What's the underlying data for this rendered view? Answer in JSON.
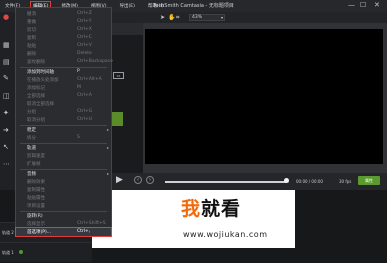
{
  "app": {
    "window_title": "TechSmith Camtasia - 无标题项目",
    "window_controls": [
      "—",
      "☐",
      "✕"
    ]
  },
  "menubar": [
    {
      "label": "文件(F)",
      "active": false
    },
    {
      "label": "编辑(E)",
      "active": true
    },
    {
      "label": "修改(M)",
      "active": false
    },
    {
      "label": "视图(V)",
      "active": false
    },
    {
      "label": "导出(E)",
      "active": false
    },
    {
      "label": "帮助(H)",
      "active": false
    }
  ],
  "toolbar": {
    "zoom_value": "43%"
  },
  "edit_menu": {
    "items": [
      {
        "label": "撤消",
        "shortcut": "Ctrl+Z",
        "state": "dim"
      },
      {
        "label": "重做",
        "shortcut": "Ctrl+Y",
        "state": "dim"
      },
      {
        "label": "剪切",
        "shortcut": "Ctrl+X",
        "state": "dim"
      },
      {
        "label": "复制",
        "shortcut": "Ctrl+C",
        "state": "dim"
      },
      {
        "label": "粘贴",
        "shortcut": "Ctrl+V",
        "state": "dim"
      },
      {
        "label": "删除",
        "shortcut": "Delete",
        "state": "dim"
      },
      {
        "label": "波纹删除",
        "shortcut": "Ctrl+Backspace",
        "state": "dim"
      },
      {
        "label": "添加到时间轴",
        "shortcut": "P",
        "state": "bright",
        "sep_before": true
      },
      {
        "label": "在播放头处添加",
        "shortcut": "Ctrl+Alt+A",
        "state": "dim"
      },
      {
        "label": "添加标记",
        "shortcut": "M",
        "state": "dim"
      },
      {
        "label": "全部选择",
        "shortcut": "Ctrl+A",
        "state": "dim"
      },
      {
        "label": "取消全部选择",
        "shortcut": "",
        "state": "dim"
      },
      {
        "label": "分组",
        "shortcut": "Ctrl+G",
        "state": "dim"
      },
      {
        "label": "取消分组",
        "shortcut": "Ctrl+U",
        "state": "dim"
      },
      {
        "label": "稳定",
        "shortcut": "",
        "state": "bright",
        "sub": true,
        "sep_before": true
      },
      {
        "label": "拆分",
        "shortcut": "S",
        "state": "dim"
      },
      {
        "label": "轨道",
        "shortcut": "",
        "state": "bright",
        "sub": true,
        "sep_before": true
      },
      {
        "label": "剪辑速度",
        "shortcut": "",
        "state": "dim"
      },
      {
        "label": "扩展帧",
        "shortcut": "",
        "state": "dim"
      },
      {
        "label": "音频",
        "shortcut": "",
        "state": "bright",
        "sub": true,
        "sep_before": true
      },
      {
        "label": "删除效果",
        "shortcut": "",
        "state": "dim"
      },
      {
        "label": "复制属性",
        "shortcut": "",
        "state": "dim"
      },
      {
        "label": "粘贴属性",
        "shortcut": "",
        "state": "dim"
      },
      {
        "label": "项目设置",
        "shortcut": "",
        "state": "dim"
      },
      {
        "label": "旋转(R)",
        "shortcut": "",
        "state": "bright",
        "sep_before": true
      },
      {
        "label": "选择显示",
        "shortcut": "Ctrl+Shift+S",
        "state": "dim"
      },
      {
        "label": "首选项(P)...",
        "shortcut": "Ctrl+,",
        "state": "highlight"
      }
    ]
  },
  "playback": {
    "time": "00:00 / 00:00",
    "fps": "30 fps",
    "properties_label": "属性",
    "progress": 0.98
  },
  "timeline": {
    "tracks": [
      {
        "label": "轨道 2"
      },
      {
        "label": "轨道 1"
      }
    ]
  },
  "watermark": {
    "logo_text_accent": "我",
    "logo_text_rest": "就看",
    "url": "www.wojiukan.com"
  }
}
